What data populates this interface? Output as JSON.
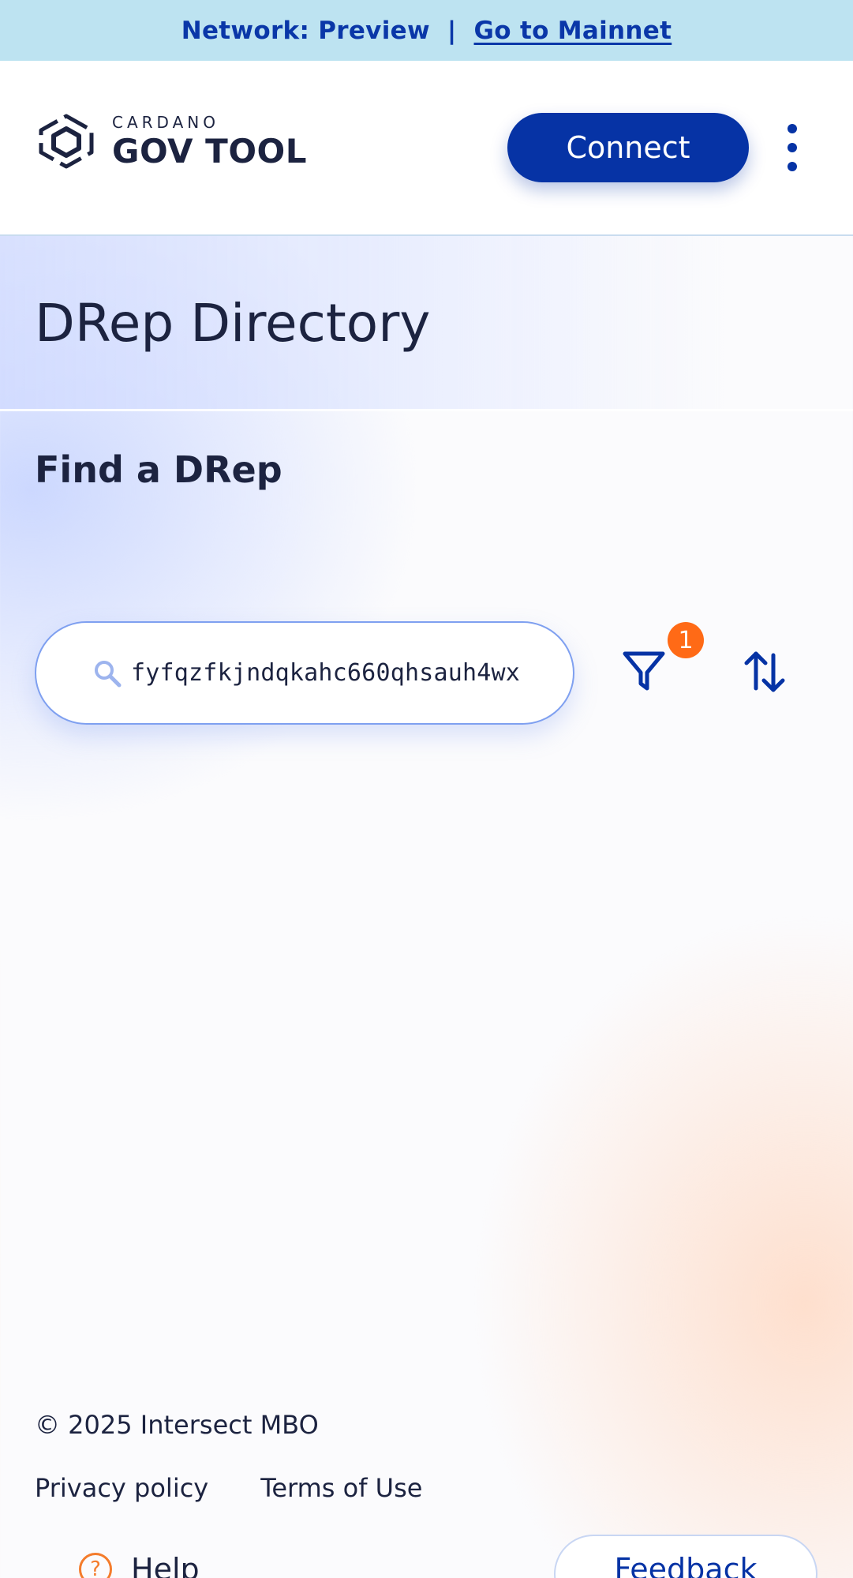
{
  "banner": {
    "network_label": "Network: Preview",
    "separator": "|",
    "mainnet_link": "Go to Mainnet"
  },
  "header": {
    "logo_small": "CARDANO",
    "logo_big": "GOV TOOL",
    "connect_label": "Connect",
    "menu_icon": "kebab-menu-icon"
  },
  "page": {
    "title": "DRep Directory",
    "section_title": "Find a DRep"
  },
  "search": {
    "value": "fyfqzfkjndqkahc660qhsauh4wx",
    "icon": "search-icon"
  },
  "toolbar": {
    "filter_icon": "filter-icon",
    "filter_count": "1",
    "sort_icon": "sort-icon"
  },
  "footer": {
    "copyright": "© 2025 Intersect MBO",
    "privacy_label": "Privacy policy",
    "terms_label": "Terms of Use",
    "help_label": "Help",
    "feedback_label": "Feedback"
  },
  "colors": {
    "primary": "#0633a5",
    "banner_bg": "#bde3f1",
    "badge": "#ff6a16",
    "text": "#1c2340"
  }
}
